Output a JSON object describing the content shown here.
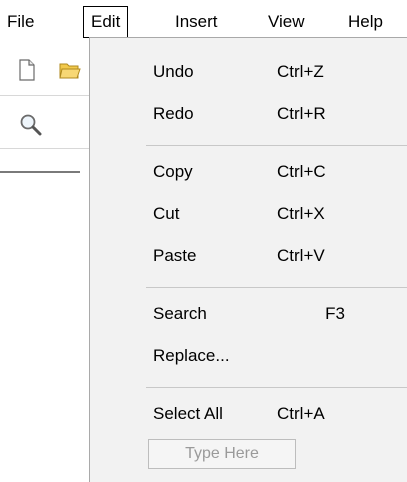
{
  "menubar": {
    "items": [
      {
        "label": "File"
      },
      {
        "label": "Edit"
      },
      {
        "label": "Insert"
      },
      {
        "label": "View"
      },
      {
        "label": "Help"
      }
    ]
  },
  "toolbar": {
    "icons": [
      "new-document-icon",
      "open-folder-icon",
      "search-icon"
    ]
  },
  "edit_menu": {
    "items": [
      {
        "label": "Undo",
        "shortcut": "Ctrl+Z"
      },
      {
        "label": "Redo",
        "shortcut": "Ctrl+R"
      },
      {
        "label": "Copy",
        "shortcut": "Ctrl+C"
      },
      {
        "label": "Cut",
        "shortcut": "Ctrl+X"
      },
      {
        "label": "Paste",
        "shortcut": "Ctrl+V"
      },
      {
        "label": "Search",
        "shortcut": "F3"
      },
      {
        "label": "Replace...",
        "shortcut": ""
      },
      {
        "label": "Select All",
        "shortcut": "Ctrl+A"
      }
    ],
    "type_here_placeholder": "Type Here"
  }
}
